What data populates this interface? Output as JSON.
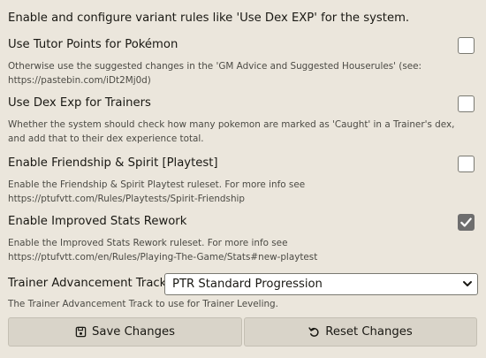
{
  "intro": "Enable and configure variant rules like 'Use Dex EXP' for the system.",
  "settings": [
    {
      "label": "Use Tutor Points for Pokémon",
      "hint": "Otherwise use the suggested changes in the 'GM Advice and Suggested Houserules' (see: https://pastebin.com/iDt2Mj0d)",
      "checked": false
    },
    {
      "label": "Use Dex Exp for Trainers",
      "hint": "Whether the system should check how many pokemon are marked as 'Caught' in a Trainer's dex, and add that to their dex experience total.",
      "checked": false
    },
    {
      "label": "Enable Friendship & Spirit [Playtest]",
      "hint": "Enable the Friendship & Spirit Playtest ruleset. For more info see https://ptufvtt.com/Rules/Playtests/Spirit-Friendship",
      "checked": false
    },
    {
      "label": "Enable Improved Stats Rework",
      "hint": "Enable the Improved Stats Rework ruleset. For more info see https://ptufvtt.com/en/Rules/Playing-The-Game/Stats#new-playtest",
      "checked": true
    }
  ],
  "track": {
    "label": "Trainer Advancement Track",
    "selected": "PTR Standard Progression",
    "hint": "The Trainer Advancement Track to use for Trainer Leveling."
  },
  "buttons": {
    "save": "Save Changes",
    "reset": "Reset Changes"
  },
  "icons": {
    "save": "floppy-disk-icon",
    "reset": "undo-icon",
    "select": "chevron-down-icon",
    "check": "checkmark-icon"
  }
}
